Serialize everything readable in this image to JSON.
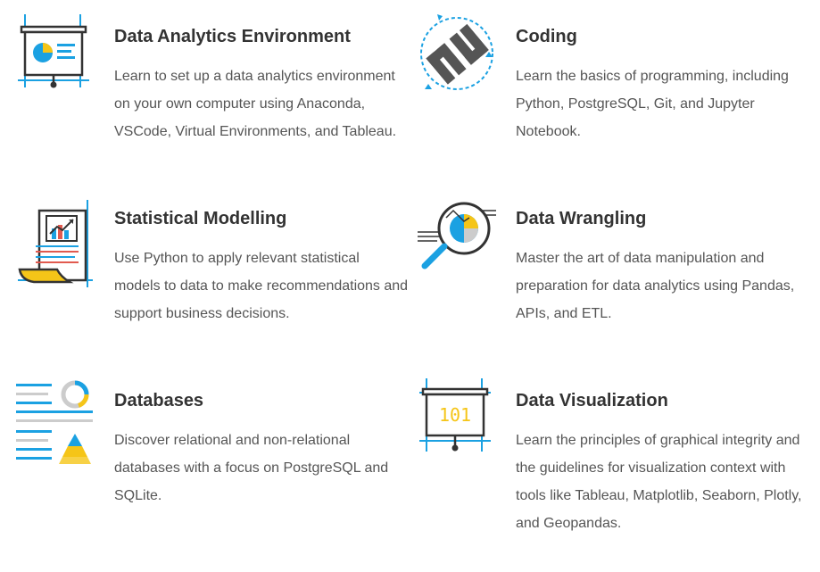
{
  "colors": {
    "blue": "#1ba1e2",
    "yellow": "#f5c518",
    "dark": "#333333",
    "gray": "#b3b3b3",
    "red": "#e15a4f"
  },
  "cards": [
    {
      "icon": "presentation-chart-icon",
      "title": "Data Analytics Environment",
      "description": "Learn to set up a data analytics environment on your own computer using Anaconda, VSCode, Virtual Environments, and Tableau."
    },
    {
      "icon": "code-cycle-icon",
      "title": "Coding",
      "description": "Learn the basics of programming, including Python, PostgreSQL, Git, and Jupyter Notebook."
    },
    {
      "icon": "report-document-icon",
      "title": "Statistical Modelling",
      "description": "Use Python to apply relevant statistical models to data to make recommendations and support business decisions."
    },
    {
      "icon": "magnifier-chart-icon",
      "title": "Data Wrangling",
      "description": "Master the art of data manipulation and preparation for data analytics using Pandas, APIs, and ETL."
    },
    {
      "icon": "database-list-icon",
      "title": "Databases",
      "description": "Discover relational and non-relational databases with a focus on PostgreSQL and SQLite."
    },
    {
      "icon": "binary-board-icon",
      "title": "Data Visualization",
      "board_text": "101",
      "description": "Learn the principles of graphical integrity and the guidelines for visualization context with tools like Tableau, Matplotlib, Seaborn, Plotly, and Geopandas."
    }
  ]
}
